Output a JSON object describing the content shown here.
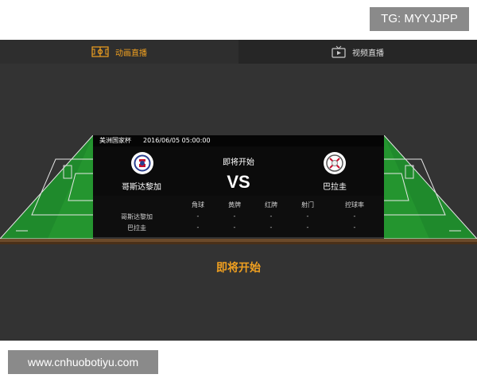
{
  "watermark_top": "TG: MYYJJPP",
  "watermark_bottom": "www.cnhuobotiyu.com",
  "tabs": [
    {
      "label": "动画直播",
      "icon": "pitch-icon"
    },
    {
      "label": "视频直播",
      "icon": "tv-icon"
    }
  ],
  "match": {
    "competition": "美洲国家杯",
    "datetime": "2016/06/05 05:00:00",
    "status": "即将开始",
    "vs": "VS",
    "home": {
      "name": "哥斯达黎加"
    },
    "away": {
      "name": "巴拉圭"
    }
  },
  "stats": {
    "headers": [
      "角球",
      "黄牌",
      "红牌",
      "射门",
      "控球率"
    ],
    "rows": [
      {
        "team": "哥斯达黎加",
        "values": [
          "-",
          "-",
          "-",
          "-",
          "-"
        ]
      },
      {
        "team": "巴拉圭",
        "values": [
          "-",
          "-",
          "-",
          "-",
          "-"
        ]
      }
    ]
  },
  "big_status": "即将开始",
  "colors": {
    "accent": "#f0a020",
    "pitch": "#1f8a2c",
    "panel": "#0b0b0b"
  }
}
